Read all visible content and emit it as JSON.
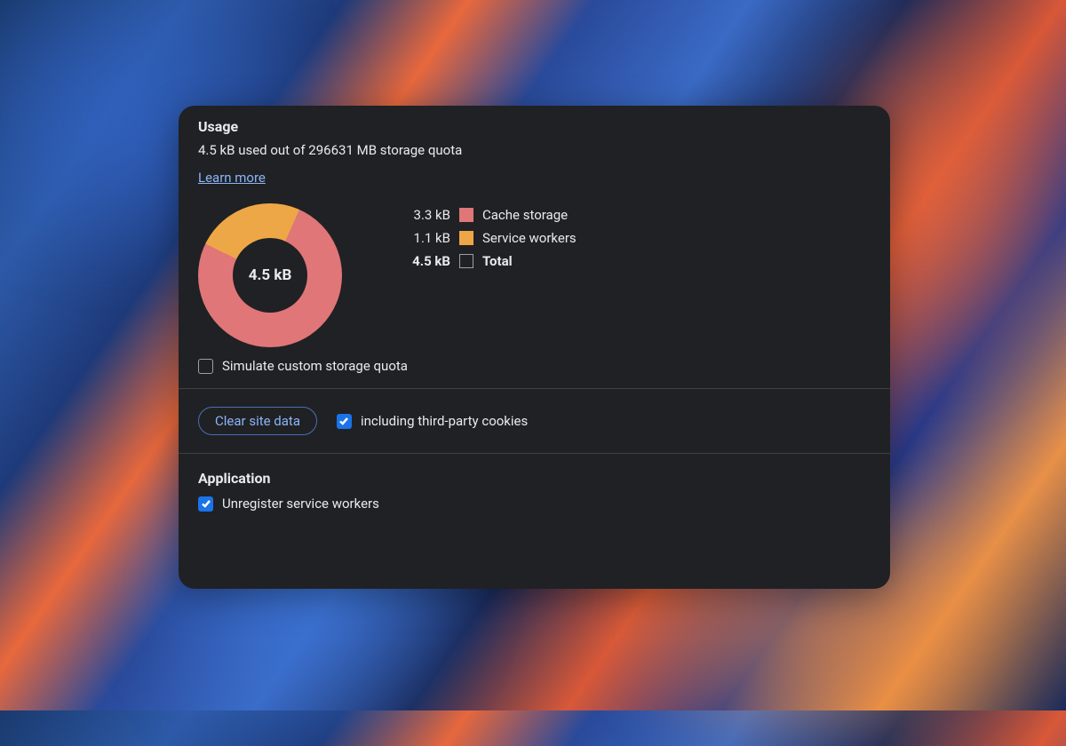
{
  "usage": {
    "title": "Usage",
    "summary": "4.5 kB used out of 296631 MB storage quota",
    "learn_more": "Learn more",
    "total_label": "4.5 kB",
    "legend": [
      {
        "value": "3.3 kB",
        "label": "Cache storage",
        "swatch": "pink",
        "bold": false
      },
      {
        "value": "1.1 kB",
        "label": "Service workers",
        "swatch": "orange",
        "bold": false
      },
      {
        "value": "4.5 kB",
        "label": "Total",
        "swatch": "outline",
        "bold": true
      }
    ],
    "simulate_label": "Simulate custom storage quota",
    "simulate_checked": false
  },
  "clear": {
    "button": "Clear site data",
    "third_party_label": "including third-party cookies",
    "third_party_checked": true
  },
  "application": {
    "title": "Application",
    "unregister_label": "Unregister service workers",
    "unregister_checked": true
  },
  "chart_data": {
    "type": "pie",
    "title": "Storage usage",
    "series": [
      {
        "name": "Cache storage",
        "value": 3.3,
        "unit": "kB",
        "color": "#e07678"
      },
      {
        "name": "Service workers",
        "value": 1.1,
        "unit": "kB",
        "color": "#eea746"
      }
    ],
    "total": {
      "value": 4.5,
      "unit": "kB"
    }
  }
}
